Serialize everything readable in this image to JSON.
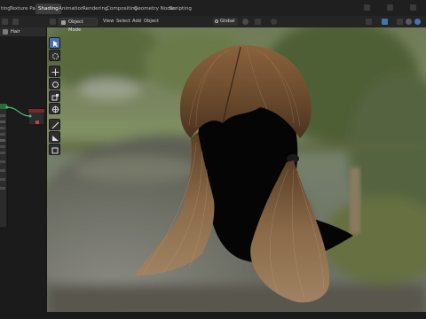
{
  "workspace_tabs": [
    "ting",
    "Texture Paint",
    "Shading",
    "Animation",
    "Rendering",
    "Compositing",
    "Geometry Nodes",
    "Scripting"
  ],
  "active_tab": "Shading",
  "left_panel": {
    "object_name": "Hair"
  },
  "viewport_header": {
    "mode": "Object Mode",
    "menus": [
      "View",
      "Select",
      "Add",
      "Object"
    ],
    "transform_orientation": "Global"
  },
  "colors": {
    "accent": "#4772b3",
    "node_socket_green": "#4fb96b",
    "hair": "#7a5634",
    "background_blur": "#5f6d4a"
  },
  "icons": {
    "select": "cursor-arrow-icon",
    "cursor": "3d-cursor-icon",
    "move": "move-icon",
    "rotate": "rotate-icon",
    "scale": "scale-icon",
    "transform": "transform-icon",
    "annotate": "annotate-icon",
    "measure": "measure-icon",
    "add_cube": "add-cube-icon"
  }
}
